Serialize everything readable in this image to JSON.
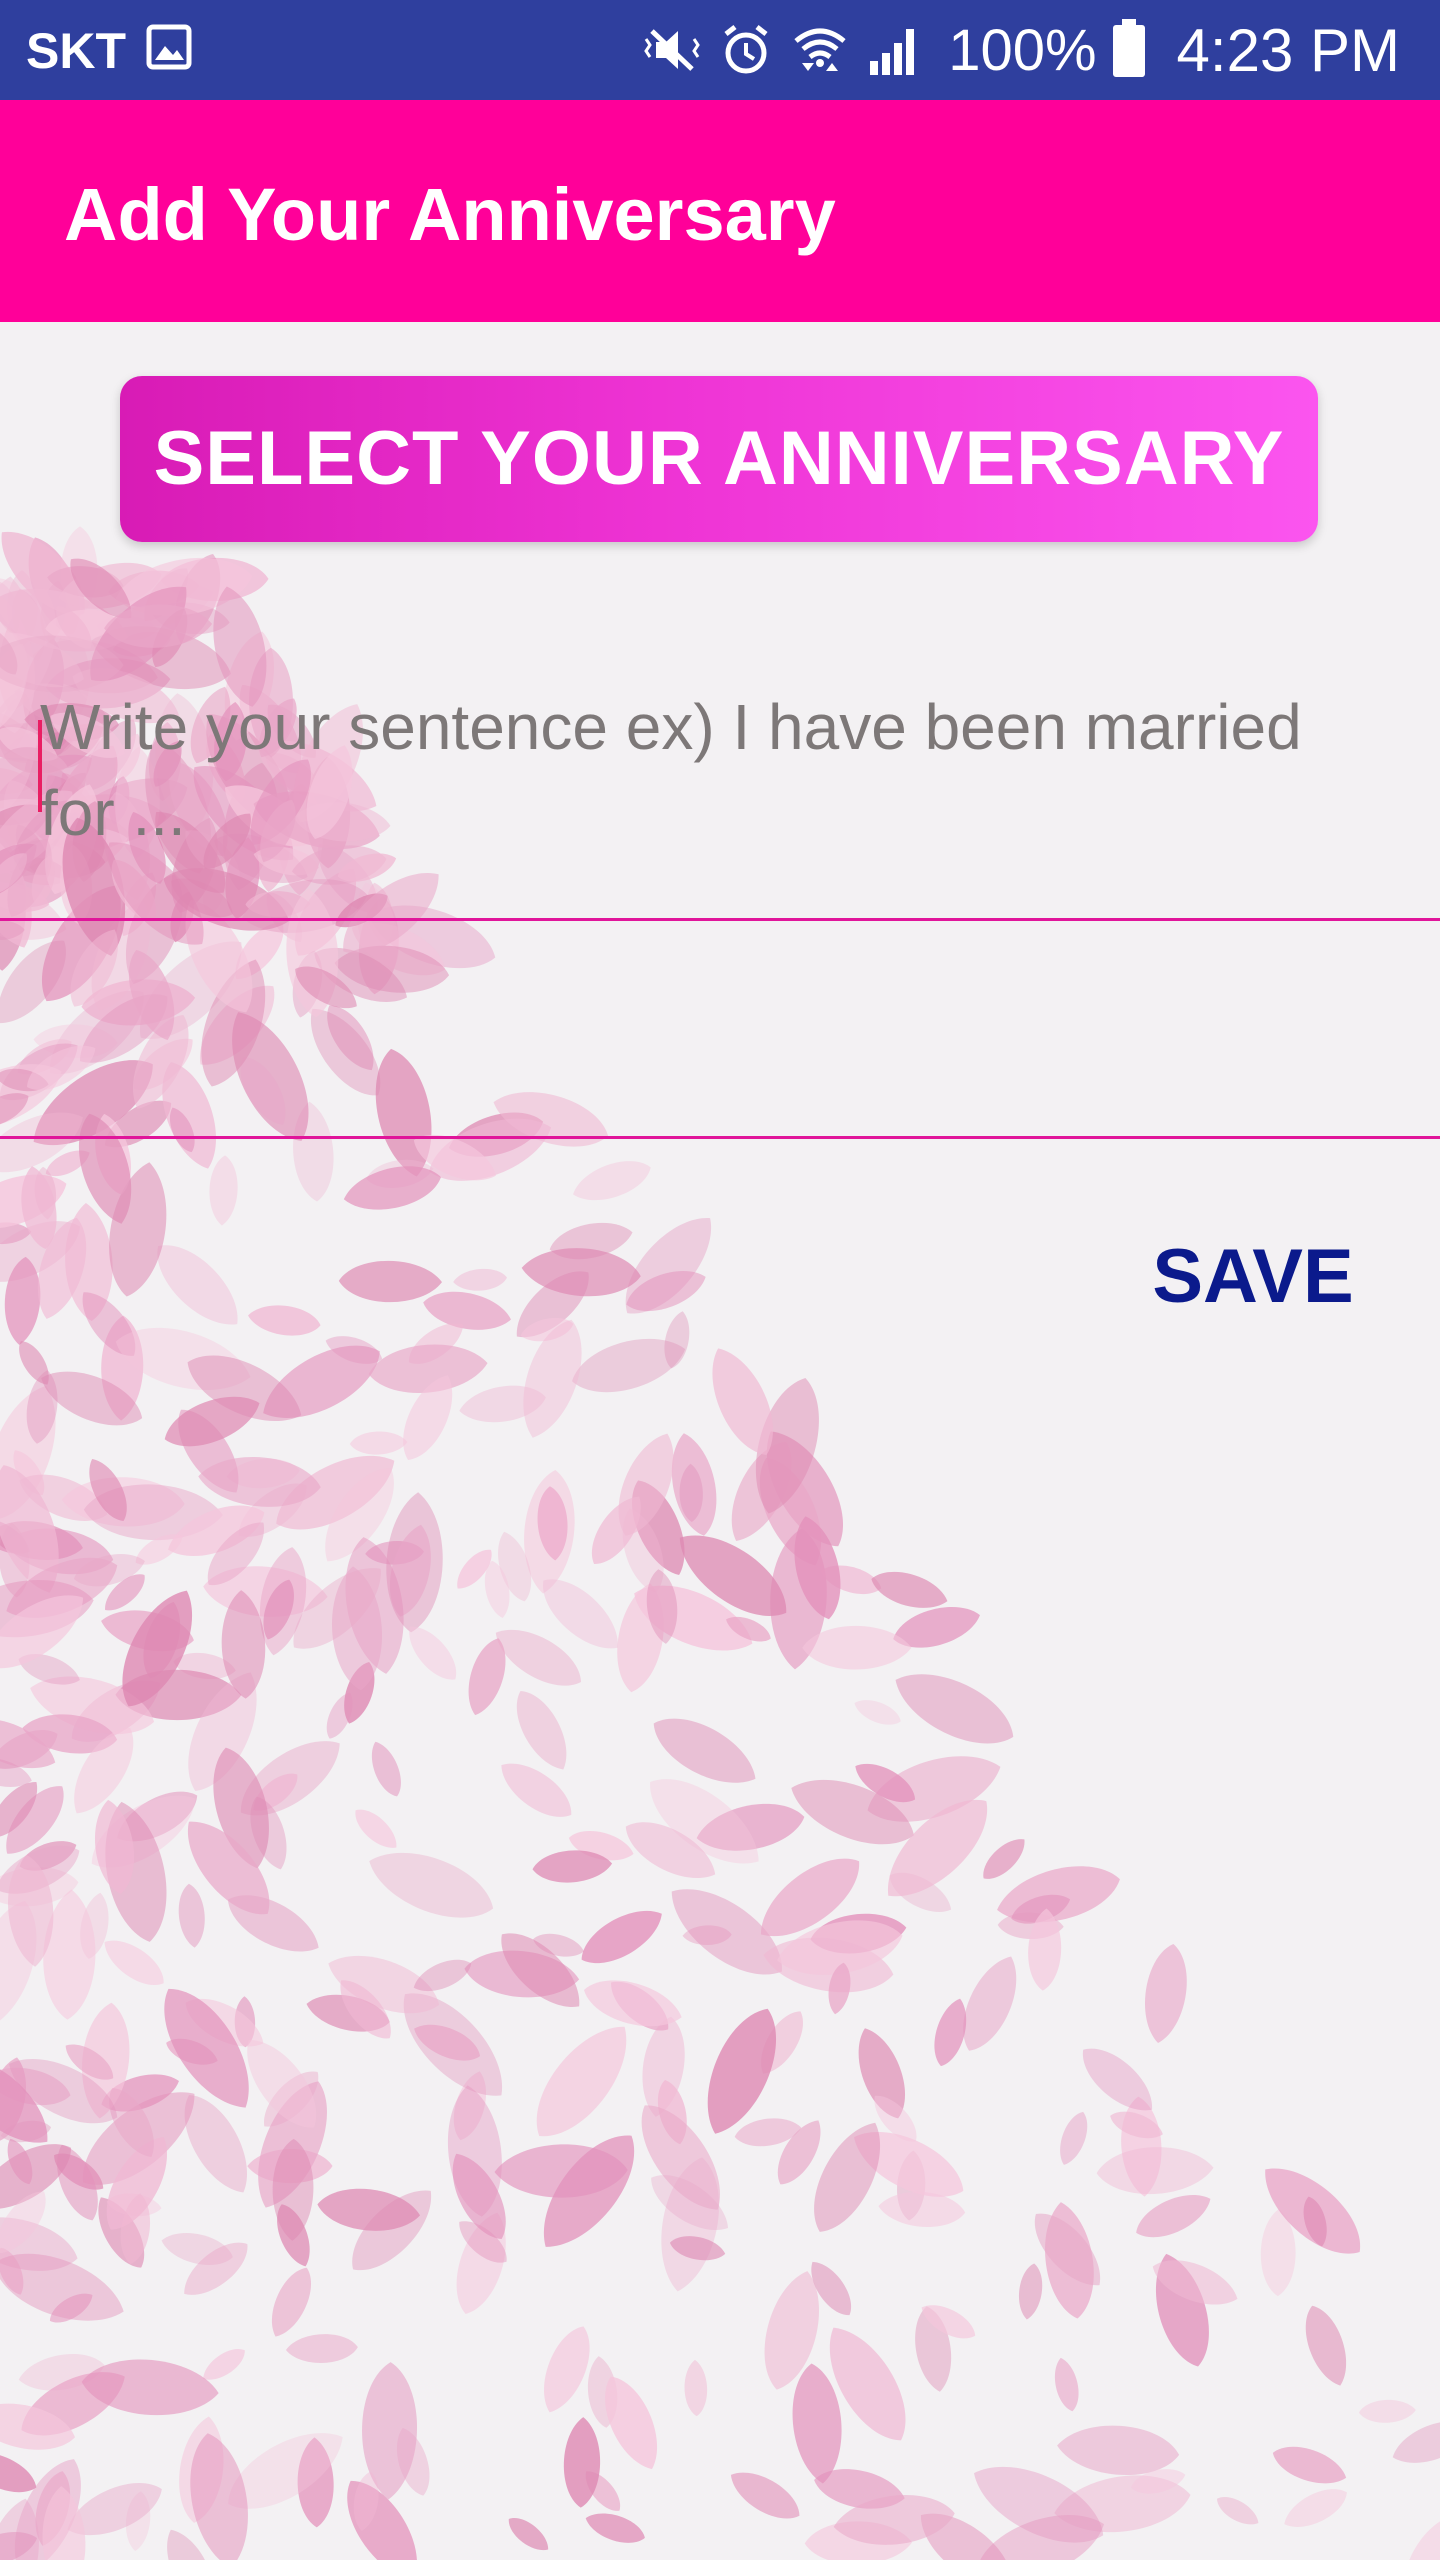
{
  "status_bar": {
    "carrier": "SKT",
    "battery": "100%",
    "time": "4:23 PM",
    "icons": [
      "image-icon",
      "mute-icon",
      "alarm-icon",
      "wifi-icon",
      "signal-icon",
      "battery-icon"
    ]
  },
  "app_bar": {
    "title": "Add Your Anniversary"
  },
  "form": {
    "select_button_label": "SELECT YOUR ANNIVERSARY",
    "sentence_placeholder": "Write your sentence ex) I have been married for ...",
    "save_label": "SAVE"
  },
  "colors": {
    "status_bar": "#2f3f9e",
    "app_bar": "#ff0099",
    "underline": "#e0159a",
    "save_text": "#0b1a8c"
  }
}
